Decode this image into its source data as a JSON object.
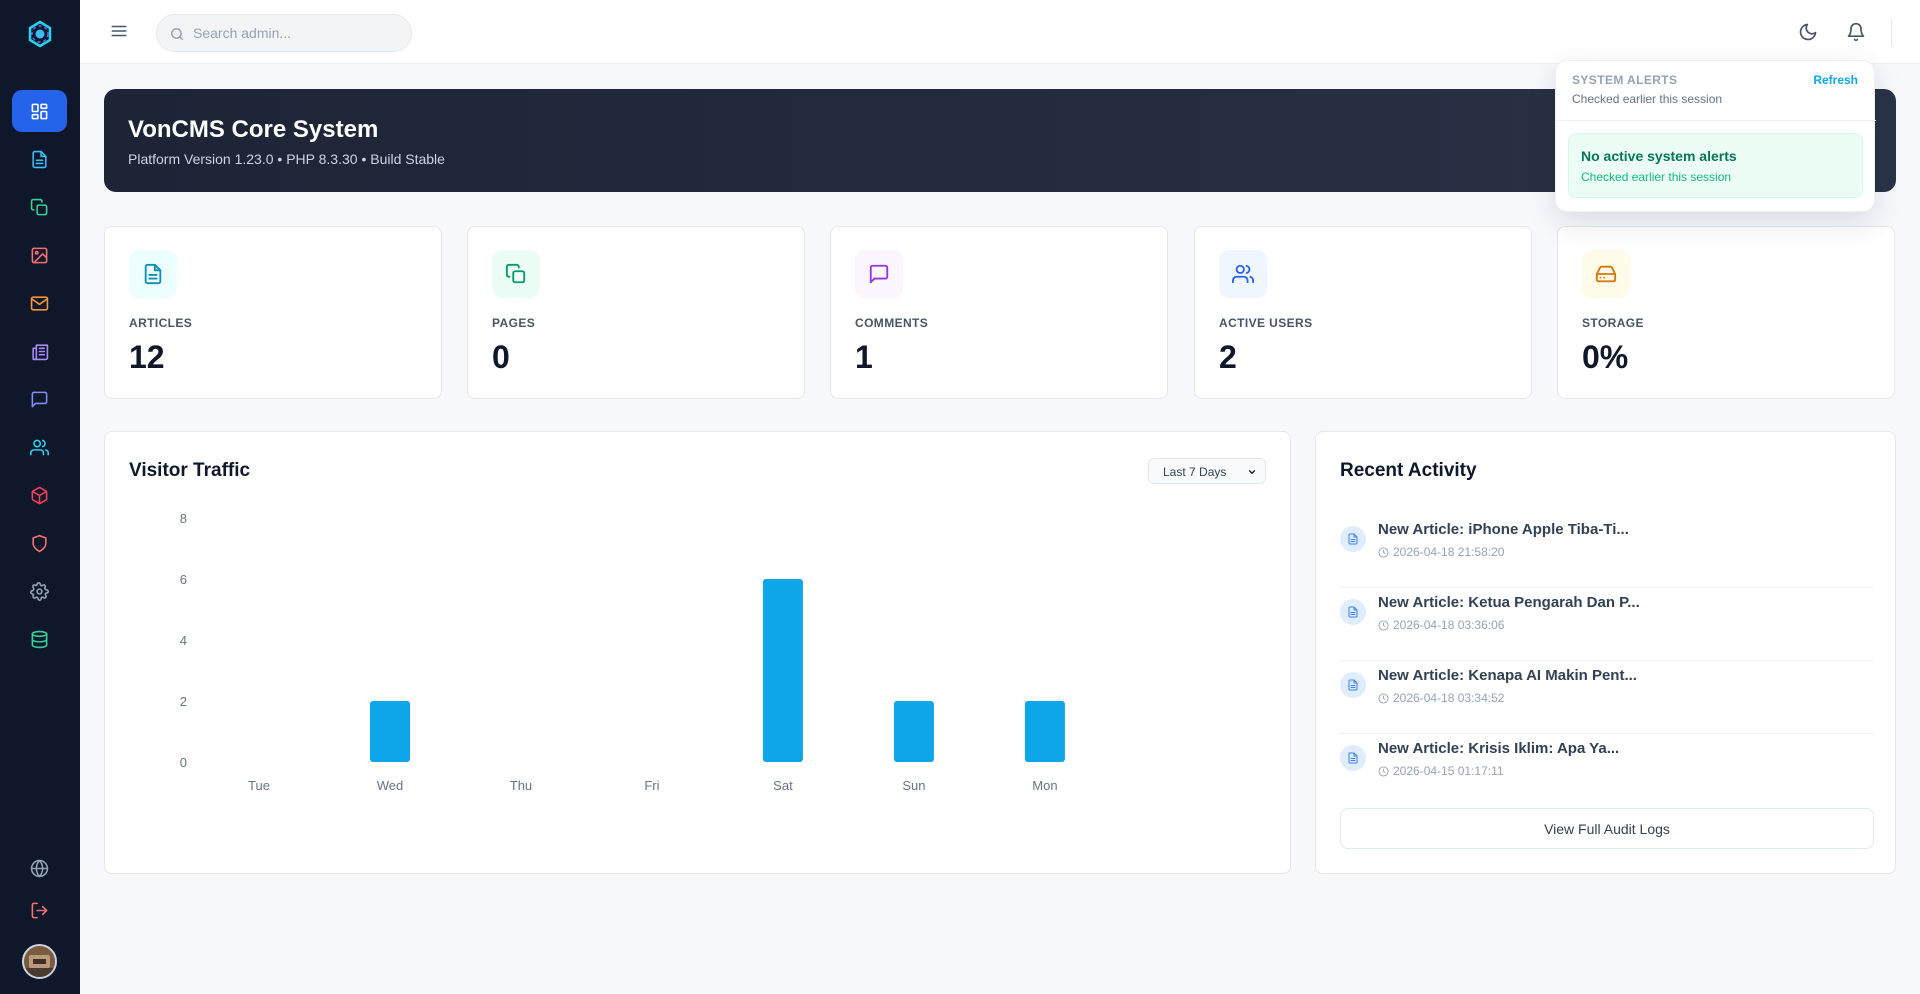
{
  "topbar": {
    "search_placeholder": "Search admin..."
  },
  "sidebar": {
    "items": [
      {
        "icon": "dashboard-icon",
        "color": "#ffffff",
        "active": true
      },
      {
        "icon": "file-text-icon",
        "color": "#38bdf8"
      },
      {
        "icon": "copy-icon",
        "color": "#34d399"
      },
      {
        "icon": "image-icon",
        "color": "#f87171"
      },
      {
        "icon": "mail-icon",
        "color": "#fb923c"
      },
      {
        "icon": "newspaper-icon",
        "color": "#a78bfa"
      },
      {
        "icon": "message-square-icon",
        "color": "#818cf8"
      },
      {
        "icon": "users-icon",
        "color": "#22d3ee"
      },
      {
        "icon": "package-icon",
        "color": "#f43f5e"
      },
      {
        "icon": "shield-icon",
        "color": "#f87171"
      },
      {
        "icon": "gear-icon",
        "color": "#94a3b8"
      },
      {
        "icon": "database-icon",
        "color": "#34d399"
      }
    ],
    "bottom": [
      {
        "icon": "globe-icon",
        "color": "#94a3b8"
      },
      {
        "icon": "logout-icon",
        "color": "#f87171"
      }
    ]
  },
  "hero": {
    "title": "VonCMS Core System",
    "subtitle": "Platform Version 1.23.0 • PHP 8.3.30 • Build Stable"
  },
  "stats": [
    {
      "label": "ARTICLES",
      "value": "12",
      "icon": "file-text-icon",
      "color": "#0891b2",
      "bg": "#ecfeff"
    },
    {
      "label": "PAGES",
      "value": "0",
      "icon": "copy-icon",
      "color": "#059669",
      "bg": "#ecfdf5"
    },
    {
      "label": "COMMENTS",
      "value": "1",
      "icon": "message-square-icon",
      "color": "#9333ea",
      "bg": "#faf5ff"
    },
    {
      "label": "ACTIVE USERS",
      "value": "2",
      "icon": "users-icon",
      "color": "#2563eb",
      "bg": "#eff6ff"
    },
    {
      "label": "STORAGE",
      "value": "0%",
      "icon": "hard-drive-icon",
      "color": "#d97706",
      "bg": "#fffbeb"
    }
  ],
  "traffic": {
    "title": "Visitor Traffic",
    "range": "Last 7 Days"
  },
  "chart_data": {
    "type": "bar",
    "categories": [
      "Tue",
      "Wed",
      "Thu",
      "Fri",
      "Sat",
      "Sun",
      "Mon"
    ],
    "values": [
      0,
      2,
      0,
      0,
      6,
      2,
      2
    ],
    "ylim": [
      0,
      8
    ],
    "yticks": [
      0,
      2,
      4,
      6,
      8
    ],
    "color": "#0ea5e9",
    "grid": false
  },
  "activity": {
    "title": "Recent Activity",
    "items": [
      {
        "title": "New Article: iPhone Apple Tiba-Ti...",
        "time": "2026-04-18 21:58:20"
      },
      {
        "title": "New Article: Ketua Pengarah Dan P...",
        "time": "2026-04-18 03:36:06"
      },
      {
        "title": "New Article: Kenapa AI Makin Pent...",
        "time": "2026-04-18 03:34:52"
      },
      {
        "title": "New Article: Krisis Iklim: Apa Ya...",
        "time": "2026-04-15 01:17:11"
      }
    ],
    "button": "View Full Audit Logs"
  },
  "alerts": {
    "heading": "SYSTEM ALERTS",
    "refresh": "Refresh",
    "subtitle": "Checked earlier this session",
    "box_title": "No active system alerts",
    "box_subtitle": "Checked earlier this session"
  }
}
